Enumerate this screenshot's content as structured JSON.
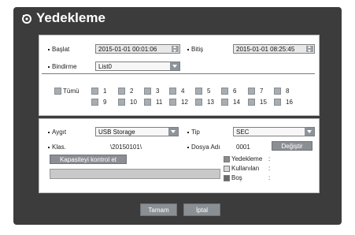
{
  "title": "Yedekleme",
  "time": {
    "start_label": "Başlat",
    "start_value": "2015-01-01 00:01:06",
    "end_label": "Bitiş",
    "end_value": "2015-01-01 08:25:45",
    "overlap_label": "Bindirme",
    "overlap_value": "List0"
  },
  "channels": {
    "all_label": "Tümü",
    "items": [
      "1",
      "2",
      "3",
      "4",
      "5",
      "6",
      "7",
      "8",
      "9",
      "10",
      "11",
      "12",
      "13",
      "14",
      "15",
      "16"
    ]
  },
  "device": {
    "device_label": "Aygıt",
    "device_value": "USB Storage",
    "type_label": "Tip",
    "type_value": "SEC",
    "folder_label": "Klas.",
    "folder_value": "\\20150101\\",
    "filename_label": "Dosya Adı",
    "filename_value": "0001",
    "change_button": "Değiştir",
    "check_capacity_button": "Kapasiteyi kontrol et",
    "legend": [
      {
        "label": "Yedekleme",
        "suffix": ":",
        "color": "#8c8c8c"
      },
      {
        "label": "Kullanılan",
        "suffix": ":",
        "color": "#d8d8d8"
      },
      {
        "label": "Boş",
        "suffix": ":",
        "color": "#6b6b6b"
      }
    ]
  },
  "footer": {
    "ok": "Tamam",
    "cancel": "İptal"
  },
  "colors": {
    "frame": "#3c3c3c",
    "button": "#8b8f94"
  }
}
